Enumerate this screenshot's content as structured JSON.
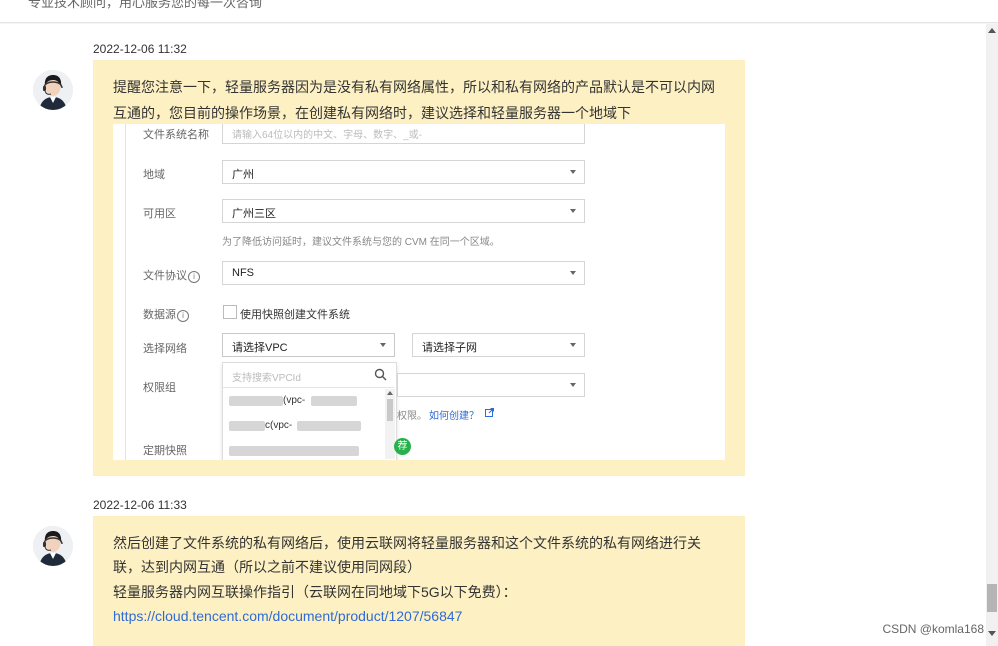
{
  "top": {
    "text": "专业技术顾问，用心服务您的每一次咨询"
  },
  "messages": [
    {
      "timestamp": "2022-12-06 11:32",
      "lines": [
        "提醒您注意一下，轻量服务器因为是没有私有网络属性，所以和私有网络的产品默认是不可以内网",
        "互通的，您目前的操作场景，在创建私有网络时，建议选择和轻量服务器一个地域下"
      ]
    },
    {
      "timestamp": "2022-12-06 11:33",
      "lines": [
        "然后创建了文件系统的私有网络后，使用云联网将轻量服务器和这个文件系统的私有网络进行关",
        "联，达到内网互通（所以之前不建议使用同网段）",
        "轻量服务器内网互联操作指引（云联网在同地域下5G以下免费）："
      ],
      "link": "https://cloud.tencent.com/document/product/1207/56847"
    }
  ],
  "form": {
    "fs_name_label": "文件系统名称",
    "fs_name_placeholder": "请输入64位以内的中文、字母、数字、_或-",
    "region_label": "地域",
    "region_value": "广州",
    "zone_label": "可用区",
    "zone_value": "广州三区",
    "zone_hint": "为了降低访问延时，建议文件系统与您的 CVM 在同一个区域。",
    "protocol_label": "文件协议",
    "protocol_value": "NFS",
    "datasource_label": "数据源",
    "snapshot_checkbox": "使用快照创建文件系统",
    "network_label": "选择网络",
    "vpc_value": "请选择VPC",
    "subnet_value": "请选择子网",
    "vpc_search_placeholder": "支持搜索VPCId",
    "vpc_options": [
      "(vpc-",
      "c(vpc-",
      ""
    ],
    "permission_label": "权限组",
    "permission_hint": "权限。",
    "how_create": "如何创建？",
    "snapshot_label": "定期快照",
    "recommend_badge": "荐"
  },
  "watermark": "CSDN @komla168"
}
